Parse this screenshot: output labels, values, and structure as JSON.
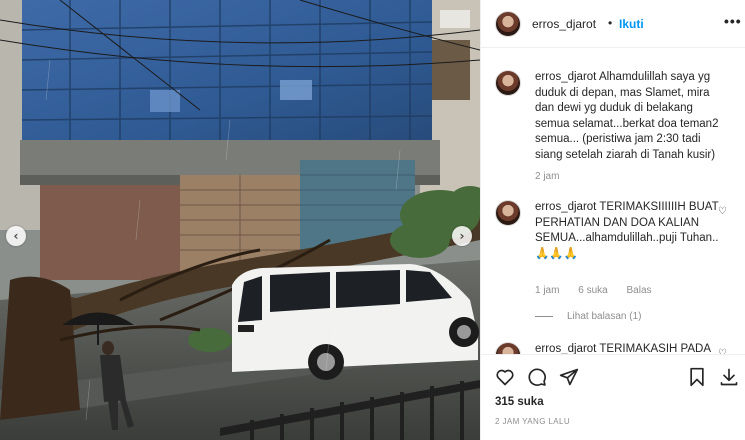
{
  "post": {
    "username": "erros_djarot",
    "separator": "•",
    "follow_label": "Ikuti",
    "more_label": "•••",
    "likes": "315 suka",
    "posted_time": "2 JAM YANG LALU"
  },
  "caption": {
    "username": "erros_djarot",
    "text": "Alhamdulillah saya yg duduk di depan, mas Slamet, mira dan dewi yg duduk di belakang semua selamat...berkat doa teman2 semua... (peristiwa jam 2:30 tadi siang setelah ziarah di Tanah kusir)",
    "time": "2 jam"
  },
  "comments": [
    {
      "username": "erros_djarot",
      "text": "TERIMAKSIIIIIIH BUAT PERHATIAN DAN DOA KALIAN SEMUA...alhamdulillah..puji Tuhan..🙏🙏🙏",
      "time": "1 jam",
      "likes": "6 suka",
      "reply_label": "Balas",
      "view_replies": "Lihat balasan (1)"
    },
    {
      "username": "erros_djarot",
      "text": "TERIMAKASIH PADA"
    }
  ],
  "icons": {
    "nav_left": "chevron-left-icon",
    "nav_right": "chevron-right-icon",
    "like": "heart-icon",
    "comment": "comment-icon",
    "share": "paper-plane-icon",
    "save": "bookmark-icon",
    "download": "download-icon"
  },
  "colors": {
    "follow": "#0095f6",
    "meta": "#8e8e8e",
    "border": "#efefef"
  }
}
